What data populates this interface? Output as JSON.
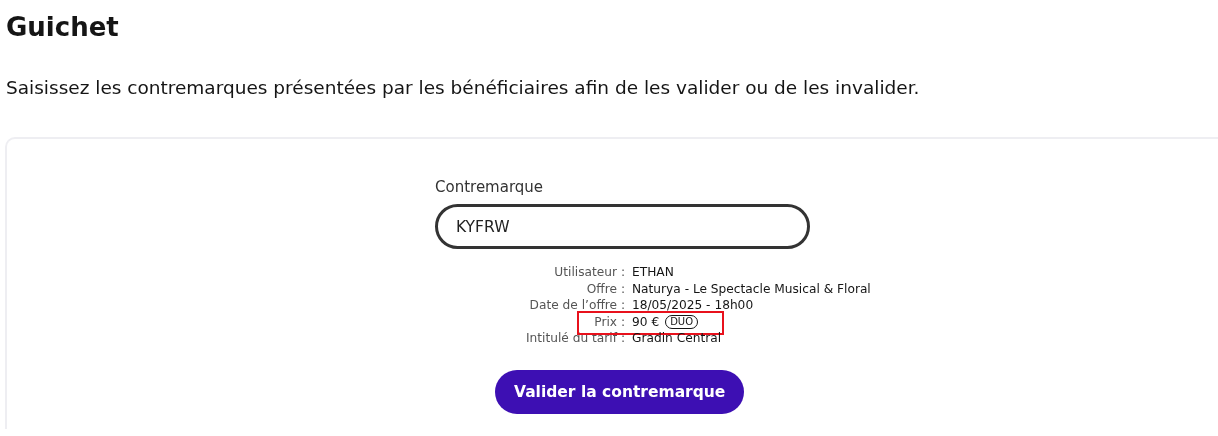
{
  "page": {
    "title": "Guichet",
    "description": "Saisissez les contremarques présentées par les bénéficiaires afin de les valider ou de les invalider."
  },
  "form": {
    "label": "Contremarque",
    "value": "KYFRW",
    "details": [
      {
        "label": "Utilisateur :",
        "value": "ETHAN",
        "highlighted": false
      },
      {
        "label": "Offre :",
        "value": "Naturya - Le Spectacle Musical & Floral",
        "highlighted": false
      },
      {
        "label": "Date de l’offre :",
        "value": "18/05/2025 - 18h00",
        "highlighted": false
      },
      {
        "label": "Prix :",
        "value": "90 €",
        "badge": "DUO",
        "highlighted": true
      },
      {
        "label": "Intitulé du tarif :",
        "value": "Gradin Central",
        "highlighted": false
      }
    ],
    "button": "Valider la contremarque"
  }
}
